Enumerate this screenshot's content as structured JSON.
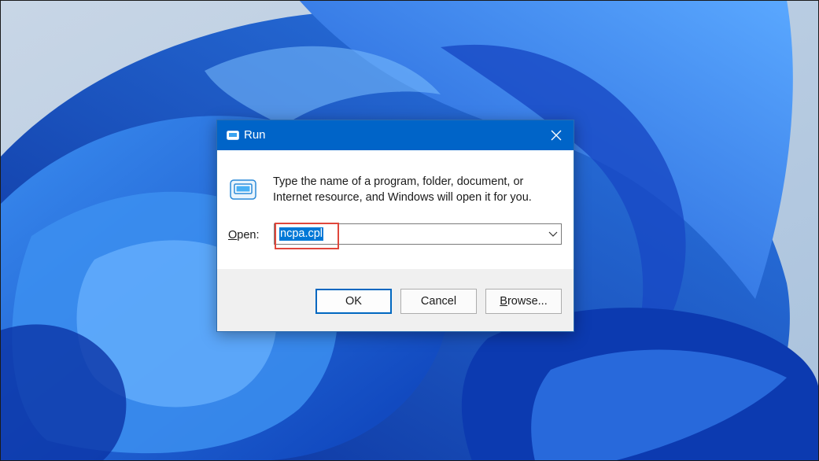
{
  "window": {
    "title": "Run",
    "close_icon": "close-icon",
    "app_icon": "run-icon"
  },
  "dialog": {
    "description_line1": "Type the name of a program, folder, document, or",
    "description_line2": "Internet resource, and Windows will open it for you.",
    "open_label_accel": "O",
    "open_label_rest": "pen:",
    "open_value": "ncpa.cpl",
    "dropdown_icon": "chevron-down-icon"
  },
  "buttons": {
    "ok": "OK",
    "cancel": "Cancel",
    "browse_accel": "B",
    "browse_rest": "rowse..."
  },
  "colors": {
    "titlebar": "#0064c8",
    "selection": "#0078d7",
    "highlight_box": "#e0473c",
    "wallpaper_base": "#1f5fd6"
  }
}
